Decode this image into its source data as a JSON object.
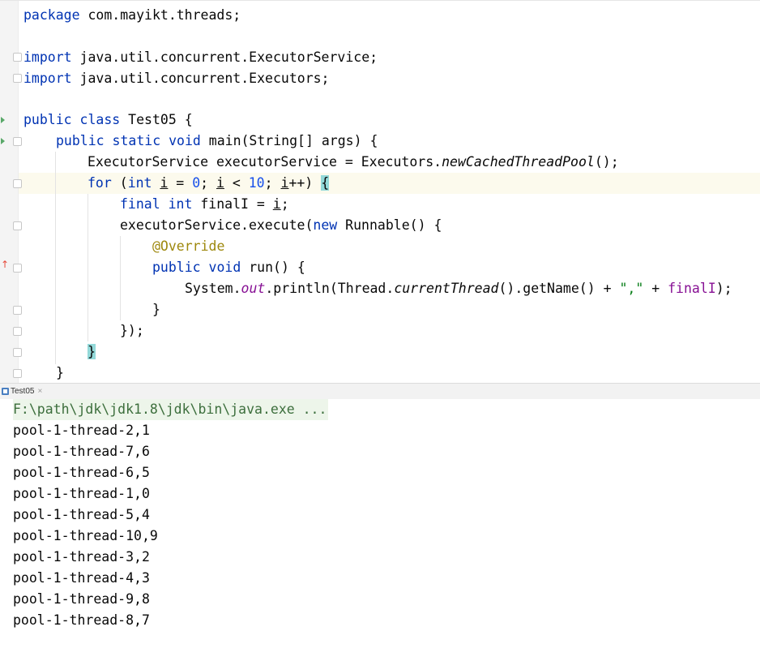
{
  "editor": {
    "package_kw": "package",
    "package_name": " com.mayikt.threads;",
    "import_kw": "import",
    "import_1": " java.util.concurrent.ExecutorService;",
    "import_2": " java.util.concurrent.Executors;",
    "l_public": "public",
    "l_class": " class",
    "class_name": " Test05 {",
    "l_static": " static",
    "l_void": " void",
    "main_sig": " main(String[] args) {",
    "exec_decl": "ExecutorService executorService = Executors.",
    "exec_method": "newCachedThreadPool",
    "exec_end": "();",
    "for_kw": "for",
    "for_open": " (",
    "int_kw": "int",
    "i_var": "i",
    "eq": " = ",
    "zero": "0",
    "semi_sp": "; ",
    "lt": " < ",
    "ten": "10",
    "inc": "++) ",
    "open_brace": "{",
    "final_kw": "final",
    "finalI_decl": " finalI = ",
    "semi": ";",
    "execute_call": "executorService.execute(",
    "new_kw": "new",
    "runnable_open": " Runnable() {",
    "override": "@Override",
    "run_sig": " run() {",
    "system": "System.",
    "out_field": "out",
    "println": ".println(Thread.",
    "current_thread": "currentThread",
    "get_name": "().getName() + ",
    "comma_str": "\",\"",
    "plus": " + ",
    "finalI": "finalI",
    "close_paren": ");",
    "close_brace": "}",
    "close_runnable": "});"
  },
  "run_tab": {
    "label": "Test05",
    "close": "×"
  },
  "console": {
    "command": "F:\\path\\jdk\\jdk1.8\\jdk\\bin\\java.exe ...",
    "lines": [
      "pool-1-thread-2,1",
      "pool-1-thread-7,6",
      "pool-1-thread-6,5",
      "pool-1-thread-1,0",
      "pool-1-thread-5,4",
      "pool-1-thread-10,9",
      "pool-1-thread-3,2",
      "pool-1-thread-4,3",
      "pool-1-thread-9,8",
      "pool-1-thread-8,7"
    ]
  },
  "colors": {
    "keyword": "#0033b3",
    "number": "#1750eb",
    "string": "#067d17",
    "annotation": "#9e880d",
    "field": "#871094",
    "brace_highlight": "#93d9d9",
    "command_bg": "#edf5ea"
  }
}
